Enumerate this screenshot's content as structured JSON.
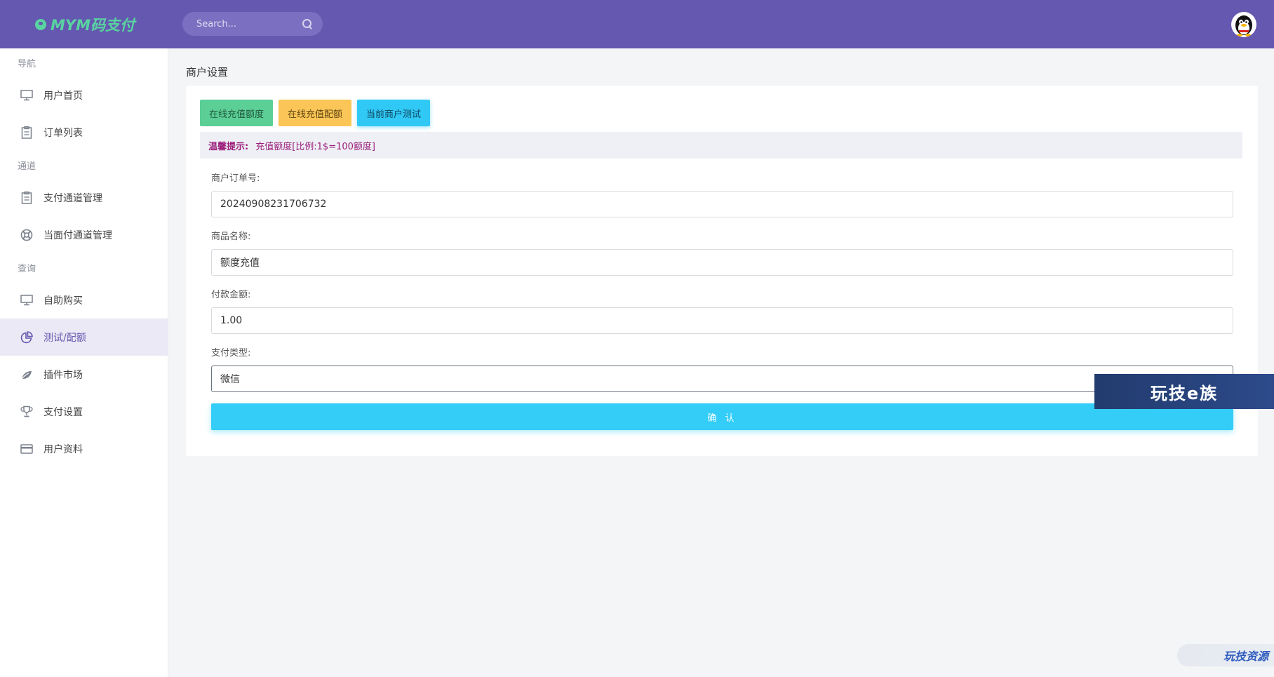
{
  "brand": {
    "name": "MYM码支付",
    "color": "#59d4a0"
  },
  "header": {
    "search_placeholder": "Search...",
    "bg_color": "#6558b0"
  },
  "sidebar": {
    "sections": [
      {
        "title": "导航",
        "items": [
          {
            "label": "用户首页",
            "icon": "monitor-icon"
          },
          {
            "label": "订单列表",
            "icon": "clipboard-icon"
          }
        ]
      },
      {
        "title": "通道",
        "items": [
          {
            "label": "支付通道管理",
            "icon": "clipboard-icon"
          },
          {
            "label": "当面付通道管理",
            "icon": "lifebuoy-icon"
          }
        ]
      },
      {
        "title": "查询",
        "items": [
          {
            "label": "自助购买",
            "icon": "monitor-icon"
          },
          {
            "label": "测试/配额",
            "icon": "pie-chart-icon",
            "active": true
          },
          {
            "label": "插件市场",
            "icon": "leaf-icon"
          },
          {
            "label": "支付设置",
            "icon": "trophy-icon"
          },
          {
            "label": "用户资料",
            "icon": "credit-card-icon"
          }
        ]
      }
    ]
  },
  "main": {
    "page_title": "商户设置",
    "tabs": [
      "在线充值额度",
      "在线充值配额",
      "当前商户测试"
    ],
    "notice": {
      "label": "温馨提示:",
      "text": "充值额度[比例:1$=100额度]"
    },
    "form": {
      "order_no_label": "商户订单号:",
      "order_no_value": "20240908231706732",
      "product_label": "商品名称:",
      "product_value": "额度充值",
      "amount_label": "付款金额:",
      "amount_value": "1.00",
      "pay_type_label": "支付类型:",
      "pay_type_value": "微信",
      "submit_label": "确 认"
    }
  },
  "watermarks": {
    "banner": "玩技e族",
    "corner": "玩技资源"
  }
}
